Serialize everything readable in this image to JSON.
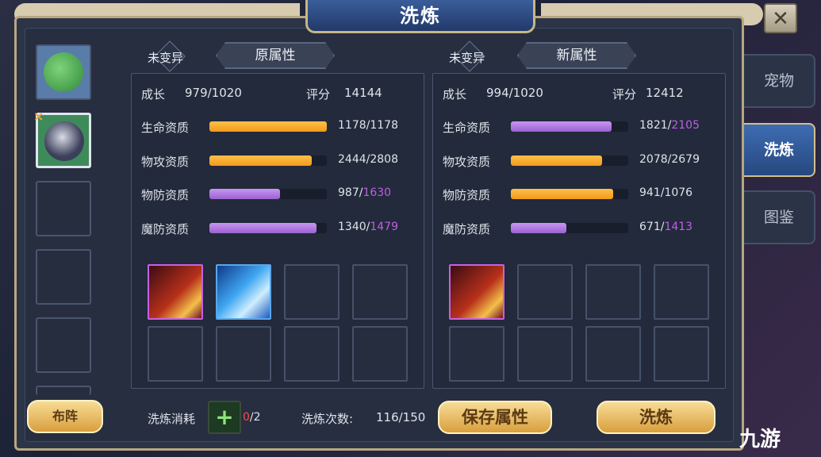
{
  "title": "洗炼",
  "close_icon": "close-x-icon",
  "tabs": [
    {
      "label": "宠物",
      "active": false
    },
    {
      "label": "洗炼",
      "active": true
    },
    {
      "label": "图鉴",
      "active": false
    }
  ],
  "pets": {
    "slots": [
      {
        "filled": true,
        "pet": "crocodile-pet-icon",
        "selected": false
      },
      {
        "filled": true,
        "pet": "badger-pet-icon",
        "selected": true,
        "marker": "×"
      },
      {
        "filled": false
      },
      {
        "filled": false
      },
      {
        "filled": false
      }
    ],
    "formation_label": "布阵"
  },
  "old": {
    "status": "未变异",
    "header": "原属性",
    "growth_label": "成长",
    "growth_value": "979/1020",
    "score_label": "评分",
    "score_value": "14144",
    "stats": [
      {
        "label": "生命资质",
        "cur": "1178",
        "max": "1178",
        "max_highlight": false,
        "color": "gold"
      },
      {
        "label": "物攻资质",
        "cur": "2444",
        "max": "2808",
        "max_highlight": false,
        "color": "gold"
      },
      {
        "label": "物防资质",
        "cur": "987",
        "max": "1630",
        "max_highlight": true,
        "color": "purple"
      },
      {
        "label": "魔防资质",
        "cur": "1340",
        "max": "1479",
        "max_highlight": true,
        "color": "purple"
      }
    ],
    "skills": [
      "claw-skill-icon",
      "ice-spikes-skill-icon",
      "",
      "",
      "",
      "",
      "",
      ""
    ]
  },
  "new": {
    "status": "未变异",
    "header": "新属性",
    "growth_label": "成长",
    "growth_value": "994/1020",
    "score_label": "评分",
    "score_value": "12412",
    "stats": [
      {
        "label": "生命资质",
        "cur": "1821",
        "max": "2105",
        "max_highlight": true,
        "color": "purple"
      },
      {
        "label": "物攻资质",
        "cur": "2078",
        "max": "2679",
        "max_highlight": false,
        "color": "gold"
      },
      {
        "label": "物防资质",
        "cur": "941",
        "max": "1076",
        "max_highlight": false,
        "color": "gold"
      },
      {
        "label": "魔防资质",
        "cur": "671",
        "max": "1413",
        "max_highlight": true,
        "color": "purple"
      }
    ],
    "skills": [
      "claw-skill-icon",
      "",
      "",
      "",
      "",
      "",
      "",
      ""
    ]
  },
  "bottom": {
    "cost_label": "洗炼消耗",
    "cost_item_icon": "green-plus-item-icon",
    "cost_have": "0",
    "cost_need": "/2",
    "count_label": "洗炼次数:",
    "count_value": "116/150",
    "save_label": "保存属性",
    "refine_label": "洗炼"
  },
  "watermark": "九游",
  "colors": {
    "gold": "#f5a623",
    "purple": "#b57ae6",
    "highlight": "#c15ee4",
    "accent_frame": "#c9b585"
  }
}
